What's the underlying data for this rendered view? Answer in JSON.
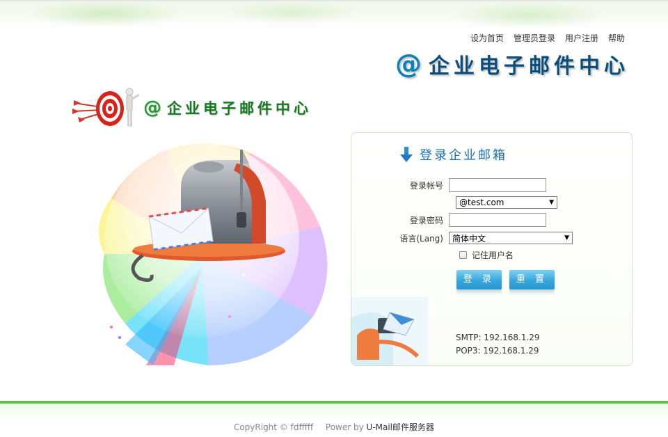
{
  "top_links": [
    "设为首页",
    "管理员登录",
    "用户注册",
    "帮助"
  ],
  "header": {
    "at_symbol": "@",
    "title": "企业电子邮件中心"
  },
  "logo": {
    "at_symbol": "@",
    "title": "企业电子邮件中心"
  },
  "login": {
    "title": "登录企业邮箱",
    "account_label": "登录帐号",
    "account_value": "",
    "domain_select": "@test.com",
    "password_label": "登录密码",
    "password_value": "",
    "language_label": "语言(Lang)",
    "language_select": "简体中文",
    "remember_label": "记住用户名",
    "remember_checked": false,
    "login_button": "登 录",
    "reset_button": "重 置"
  },
  "server": {
    "smtp": "SMTP: 192.168.1.29",
    "pop3": "POP3: 192.168.1.29"
  },
  "footer": {
    "copyright": "CopyRight © fdfffff",
    "power_prefix": "Power by ",
    "power_brand": "U-Mail邮件服务器"
  },
  "colors": {
    "accent_blue": "#0d7fb9",
    "accent_green": "#1f9a2e",
    "footer_green": "#5cc43d",
    "button_blue": "#37a6dc"
  }
}
